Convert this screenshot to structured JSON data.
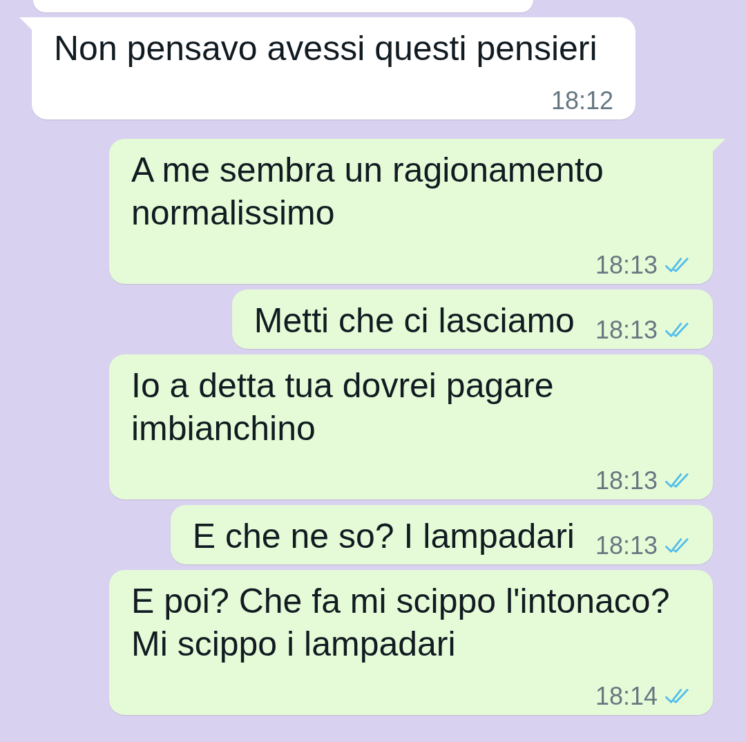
{
  "messages": [
    {
      "kind": "incoming",
      "cut_off": true
    },
    {
      "kind": "incoming",
      "tail": true,
      "text": "Non pensavo avessi questi pensieri",
      "time": "18:12"
    },
    {
      "kind": "outgoing",
      "tail": true,
      "text": "A me sembra un ragionamento normalissimo",
      "time": "18:13",
      "read": true
    },
    {
      "kind": "outgoing",
      "tail": false,
      "text": "Metti che ci lasciamo",
      "time": "18:13",
      "read": true
    },
    {
      "kind": "outgoing",
      "tail": false,
      "text": "Io a detta tua dovrei pagare imbianchino",
      "time": "18:13",
      "read": true
    },
    {
      "kind": "outgoing",
      "tail": false,
      "text": "E che ne so? I lampadari",
      "time": "18:13",
      "read": true
    },
    {
      "kind": "outgoing",
      "tail": false,
      "text": "E poi? Che fa mi scippo l'intonaco? Mi scippo i lampadari",
      "time": "18:14",
      "read": true
    }
  ]
}
